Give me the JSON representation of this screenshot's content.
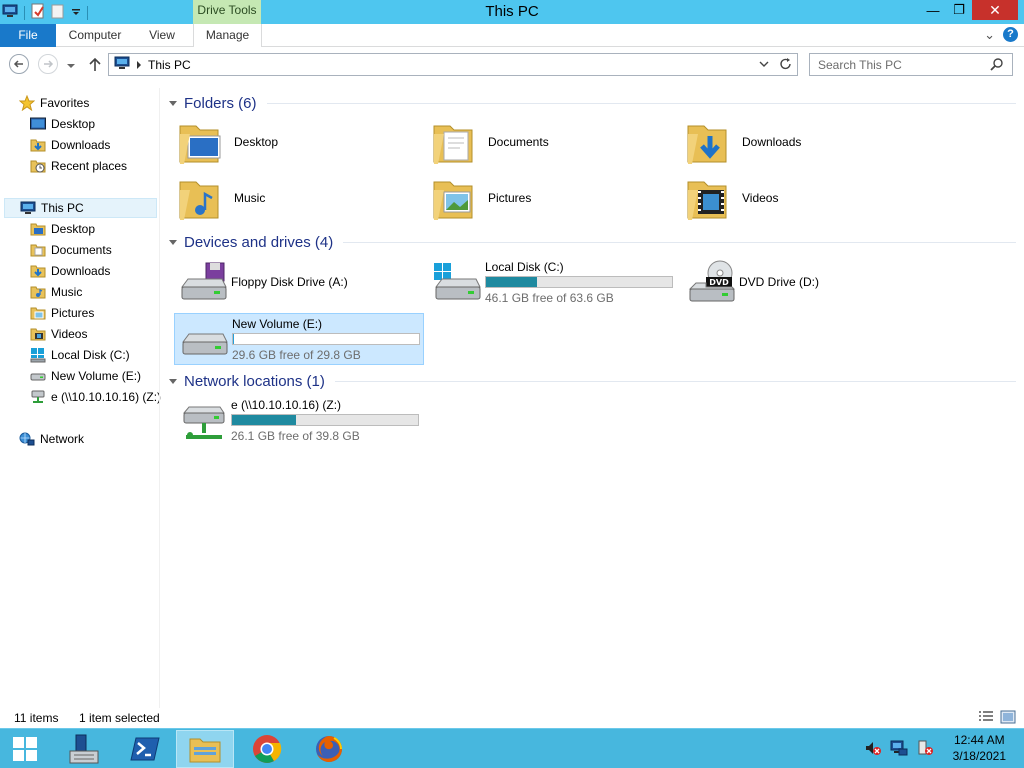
{
  "window": {
    "title": "This PC",
    "contextual_tab": "Drive Tools",
    "controls": {
      "minimize": "—",
      "maximize": "❐",
      "close": "✕"
    }
  },
  "ribbon": {
    "tabs": [
      {
        "label": "File"
      },
      {
        "label": "Computer"
      },
      {
        "label": "View"
      },
      {
        "label": "Manage"
      }
    ],
    "expand_glyph": "⌄",
    "help_glyph": "?"
  },
  "address_bar": {
    "path": "This PC",
    "search_placeholder": "Search This PC"
  },
  "sidebar": {
    "favorites": {
      "label": "Favorites",
      "items": [
        {
          "label": "Desktop",
          "icon": "desktop-icon"
        },
        {
          "label": "Downloads",
          "icon": "downloads-folder-icon"
        },
        {
          "label": "Recent places",
          "icon": "recent-places-icon"
        }
      ]
    },
    "this_pc": {
      "label": "This PC",
      "items": [
        {
          "label": "Desktop"
        },
        {
          "label": "Documents"
        },
        {
          "label": "Downloads"
        },
        {
          "label": "Music"
        },
        {
          "label": "Pictures"
        },
        {
          "label": "Videos"
        },
        {
          "label": "Local Disk (C:)"
        },
        {
          "label": "New Volume (E:)"
        },
        {
          "label": "e (\\\\10.10.10.16) (Z:)"
        }
      ]
    },
    "network": {
      "label": "Network"
    }
  },
  "content": {
    "folders_header": "Folders (6)",
    "folders": [
      {
        "label": "Desktop",
        "icon": "desktop-folder-icon"
      },
      {
        "label": "Documents",
        "icon": "documents-folder-icon"
      },
      {
        "label": "Downloads",
        "icon": "downloads-folder-icon"
      },
      {
        "label": "Music",
        "icon": "music-folder-icon"
      },
      {
        "label": "Pictures",
        "icon": "pictures-folder-icon"
      },
      {
        "label": "Videos",
        "icon": "videos-folder-icon"
      }
    ],
    "devices_header": "Devices and drives (4)",
    "drives": [
      {
        "label": "Floppy Disk Drive (A:)",
        "icon": "floppy-drive-icon"
      },
      {
        "label": "Local Disk (C:)",
        "free": "46.1 GB free of 63.6 GB",
        "used_fraction": 0.275,
        "icon": "windows-drive-icon"
      },
      {
        "label": "DVD Drive (D:)",
        "icon": "dvd-drive-icon",
        "badge": "DVD"
      },
      {
        "label": "New Volume (E:)",
        "free": "29.6 GB free of 29.8 GB",
        "used_fraction": 0.007,
        "icon": "hard-drive-icon",
        "selected": true
      }
    ],
    "network_header": "Network locations (1)",
    "network_drives": [
      {
        "label": "e (\\\\10.10.10.16) (Z:)",
        "free": "26.1 GB free of 39.8 GB",
        "used_fraction": 0.344,
        "icon": "network-drive-icon"
      }
    ]
  },
  "status_bar": {
    "item_count": "11 items",
    "selection": "1 item selected"
  },
  "taskbar": {
    "clock_time": "12:44 AM",
    "clock_date": "3/18/2021"
  }
}
